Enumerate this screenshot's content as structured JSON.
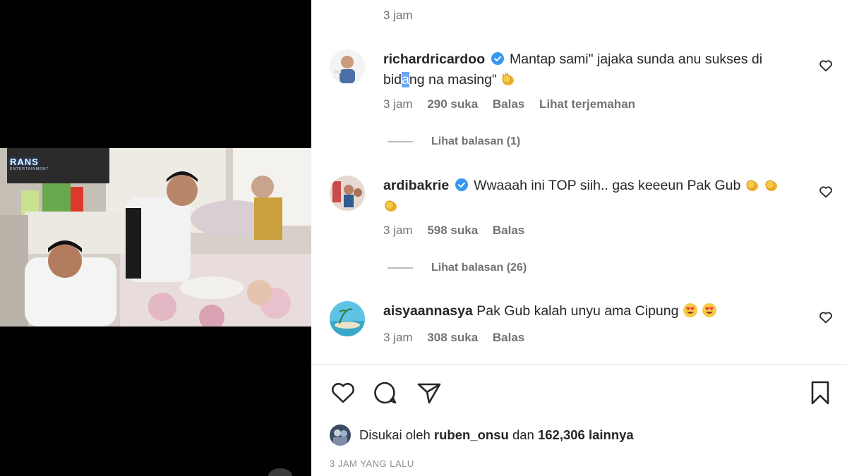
{
  "video": {
    "channel_logo": "RANS",
    "channel_sub": "ENTERTAINMENT"
  },
  "comments_header": {
    "top_time": "3 jam"
  },
  "comments": [
    {
      "username": "richardricardoo",
      "text_a": "Mantap sami\" jajaka sunda anu sukses di bid",
      "text_highlight": "a",
      "text_b": "ng na masing\"",
      "emoji": "clapping-hands",
      "time": "3 jam",
      "likes": "290 suka",
      "reply": "Balas",
      "translate": "Lihat terjemahan",
      "view_replies": "Lihat balasan (1)"
    },
    {
      "username": "ardibakrie",
      "text": "Wwaaah ini TOP siih.. gas keeeun Pak Gub",
      "emoji": "clapping-hands",
      "time": "3 jam",
      "likes": "598 suka",
      "reply": "Balas",
      "view_replies": "Lihat balasan (26)"
    },
    {
      "username": "aisyaannasya",
      "text": "Pak Gub kalah unyu ama Cipung",
      "emoji": "heart-eyes",
      "time": "3 jam",
      "likes": "308 suka",
      "reply": "Balas"
    }
  ],
  "likes_summary": {
    "prefix": "Disukai oleh",
    "user": "ruben_onsu",
    "middle": "dan",
    "count": "162,306 lainnya"
  },
  "posted_time": "3 JAM YANG LALU",
  "colors": {
    "verified": "#3897f0",
    "text": "#262626",
    "muted": "#737373",
    "highlight": "#6aa7f5"
  }
}
